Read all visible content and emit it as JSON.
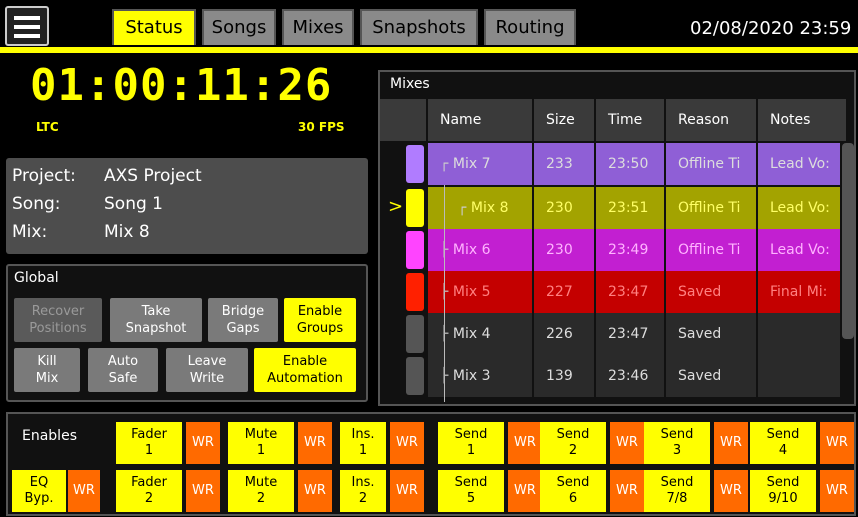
{
  "topbar": {
    "tabs": [
      "Status",
      "Songs",
      "Mixes",
      "Snapshots",
      "Routing"
    ],
    "datetime": "02/08/2020 23:59"
  },
  "timecode": {
    "value": "01:00:11:26",
    "source": "LTC",
    "fps": "30 FPS"
  },
  "info": {
    "project_label": "Project:",
    "project_value": "AXS Project",
    "song_label": "Song:",
    "song_value": "Song 1",
    "mix_label": "Mix:",
    "mix_value": "Mix 8"
  },
  "global": {
    "title": "Global",
    "buttons": [
      "Recover\nPositions",
      "Take\nSnapshot",
      "Bridge\nGaps",
      "Enable\nGroups",
      "Kill\nMix",
      "Auto\nSafe",
      "Leave\nWrite",
      "Enable\nAutomation"
    ]
  },
  "mixes": {
    "title": "Mixes",
    "columns": [
      "Name",
      "Size",
      "Time",
      "Reason",
      "Notes"
    ],
    "rows": [
      {
        "name": "Mix 7",
        "size": "233",
        "time": "23:50",
        "reason": "Offline Ti",
        "notes": "Lead Vo:"
      },
      {
        "name": "Mix 8",
        "size": "230",
        "time": "23:51",
        "reason": "Offline Ti",
        "notes": "Lead Vo:",
        "marker": ">"
      },
      {
        "name": "Mix 6",
        "size": "230",
        "time": "23:49",
        "reason": "Offline Ti",
        "notes": "Lead Vo:"
      },
      {
        "name": "Mix 5",
        "size": "227",
        "time": "23:47",
        "reason": "Saved",
        "notes": "Final Mi:"
      },
      {
        "name": "Mix 4",
        "size": "226",
        "time": "23:47",
        "reason": "Saved",
        "notes": ""
      },
      {
        "name": "Mix 3",
        "size": "139",
        "time": "23:46",
        "reason": "Saved",
        "notes": ""
      }
    ]
  },
  "enables": {
    "title": "Enables",
    "wr_label": "WR",
    "row1": [
      "Fader\n1",
      "Mute\n1",
      "Ins.\n1",
      "Send\n1",
      "Send\n2",
      "Send\n3",
      "Send\n4"
    ],
    "row2": [
      "EQ\nByp.",
      "Fader\n2",
      "Mute\n2",
      "Ins.\n2",
      "Send\n5",
      "Send\n6",
      "Send\n7/8",
      "Send\n9/10"
    ]
  },
  "colors": {
    "accent": "#ffff00",
    "write": "#ff6a00",
    "mix7": "#8f5fd6",
    "mix8": "#a3a300",
    "mix6": "#c21fd1",
    "mix5": "#c40000"
  }
}
